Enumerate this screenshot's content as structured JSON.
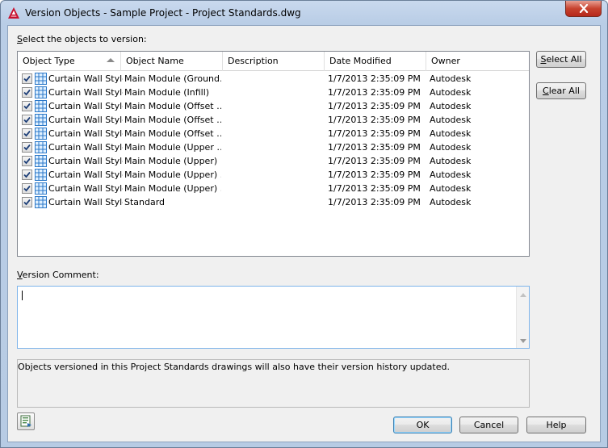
{
  "window": {
    "title": "Version Objects - Sample Project - Project Standards.dwg"
  },
  "prompt": {
    "prefix": "",
    "accel": "S",
    "rest": "elect the objects to version:"
  },
  "table": {
    "columns": [
      "Object Type",
      "Object Name",
      "Description",
      "Date Modified",
      "Owner"
    ],
    "rows": [
      {
        "checked": true,
        "type": "Curtain Wall Style",
        "name": "Main Module (Ground…",
        "description": "",
        "date": "1/7/2013 2:35:09 PM",
        "owner": "Autodesk"
      },
      {
        "checked": true,
        "type": "Curtain Wall Style",
        "name": "Main Module (Infill)",
        "description": "",
        "date": "1/7/2013 2:35:09 PM",
        "owner": "Autodesk"
      },
      {
        "checked": true,
        "type": "Curtain Wall Style",
        "name": "Main Module (Offset …",
        "description": "",
        "date": "1/7/2013 2:35:09 PM",
        "owner": "Autodesk"
      },
      {
        "checked": true,
        "type": "Curtain Wall Style",
        "name": "Main Module (Offset …",
        "description": "",
        "date": "1/7/2013 2:35:09 PM",
        "owner": "Autodesk"
      },
      {
        "checked": true,
        "type": "Curtain Wall Style",
        "name": "Main Module (Offset …",
        "description": "",
        "date": "1/7/2013 2:35:09 PM",
        "owner": "Autodesk"
      },
      {
        "checked": true,
        "type": "Curtain Wall Style",
        "name": "Main Module (Upper …",
        "description": "",
        "date": "1/7/2013 2:35:09 PM",
        "owner": "Autodesk"
      },
      {
        "checked": true,
        "type": "Curtain Wall Style",
        "name": "Main Module (Upper)",
        "description": "",
        "date": "1/7/2013 2:35:09 PM",
        "owner": "Autodesk"
      },
      {
        "checked": true,
        "type": "Curtain Wall Style",
        "name": "Main Module (Upper) …",
        "description": "",
        "date": "1/7/2013 2:35:09 PM",
        "owner": "Autodesk"
      },
      {
        "checked": true,
        "type": "Curtain Wall Style",
        "name": "Main Module (Upper) …",
        "description": "",
        "date": "1/7/2013 2:35:09 PM",
        "owner": "Autodesk"
      },
      {
        "checked": true,
        "type": "Curtain Wall Style",
        "name": "Standard",
        "description": "",
        "date": "1/7/2013 2:35:09 PM",
        "owner": "Autodesk"
      }
    ]
  },
  "side_buttons": {
    "select_all": {
      "accel": "S",
      "rest": "elect All"
    },
    "clear_all": {
      "accel": "C",
      "rest": "lear All"
    }
  },
  "comment": {
    "accel": "V",
    "rest": "ersion Comment:",
    "value": ""
  },
  "info": {
    "text": "Objects versioned in this Project Standards drawings will also have their version history updated."
  },
  "footer": {
    "ok": "OK",
    "cancel": "Cancel",
    "help": "Help"
  },
  "icons": {
    "app": "autocad-app-icon",
    "row": "curtain-wall-style-icon",
    "tool": "export-report-icon"
  }
}
